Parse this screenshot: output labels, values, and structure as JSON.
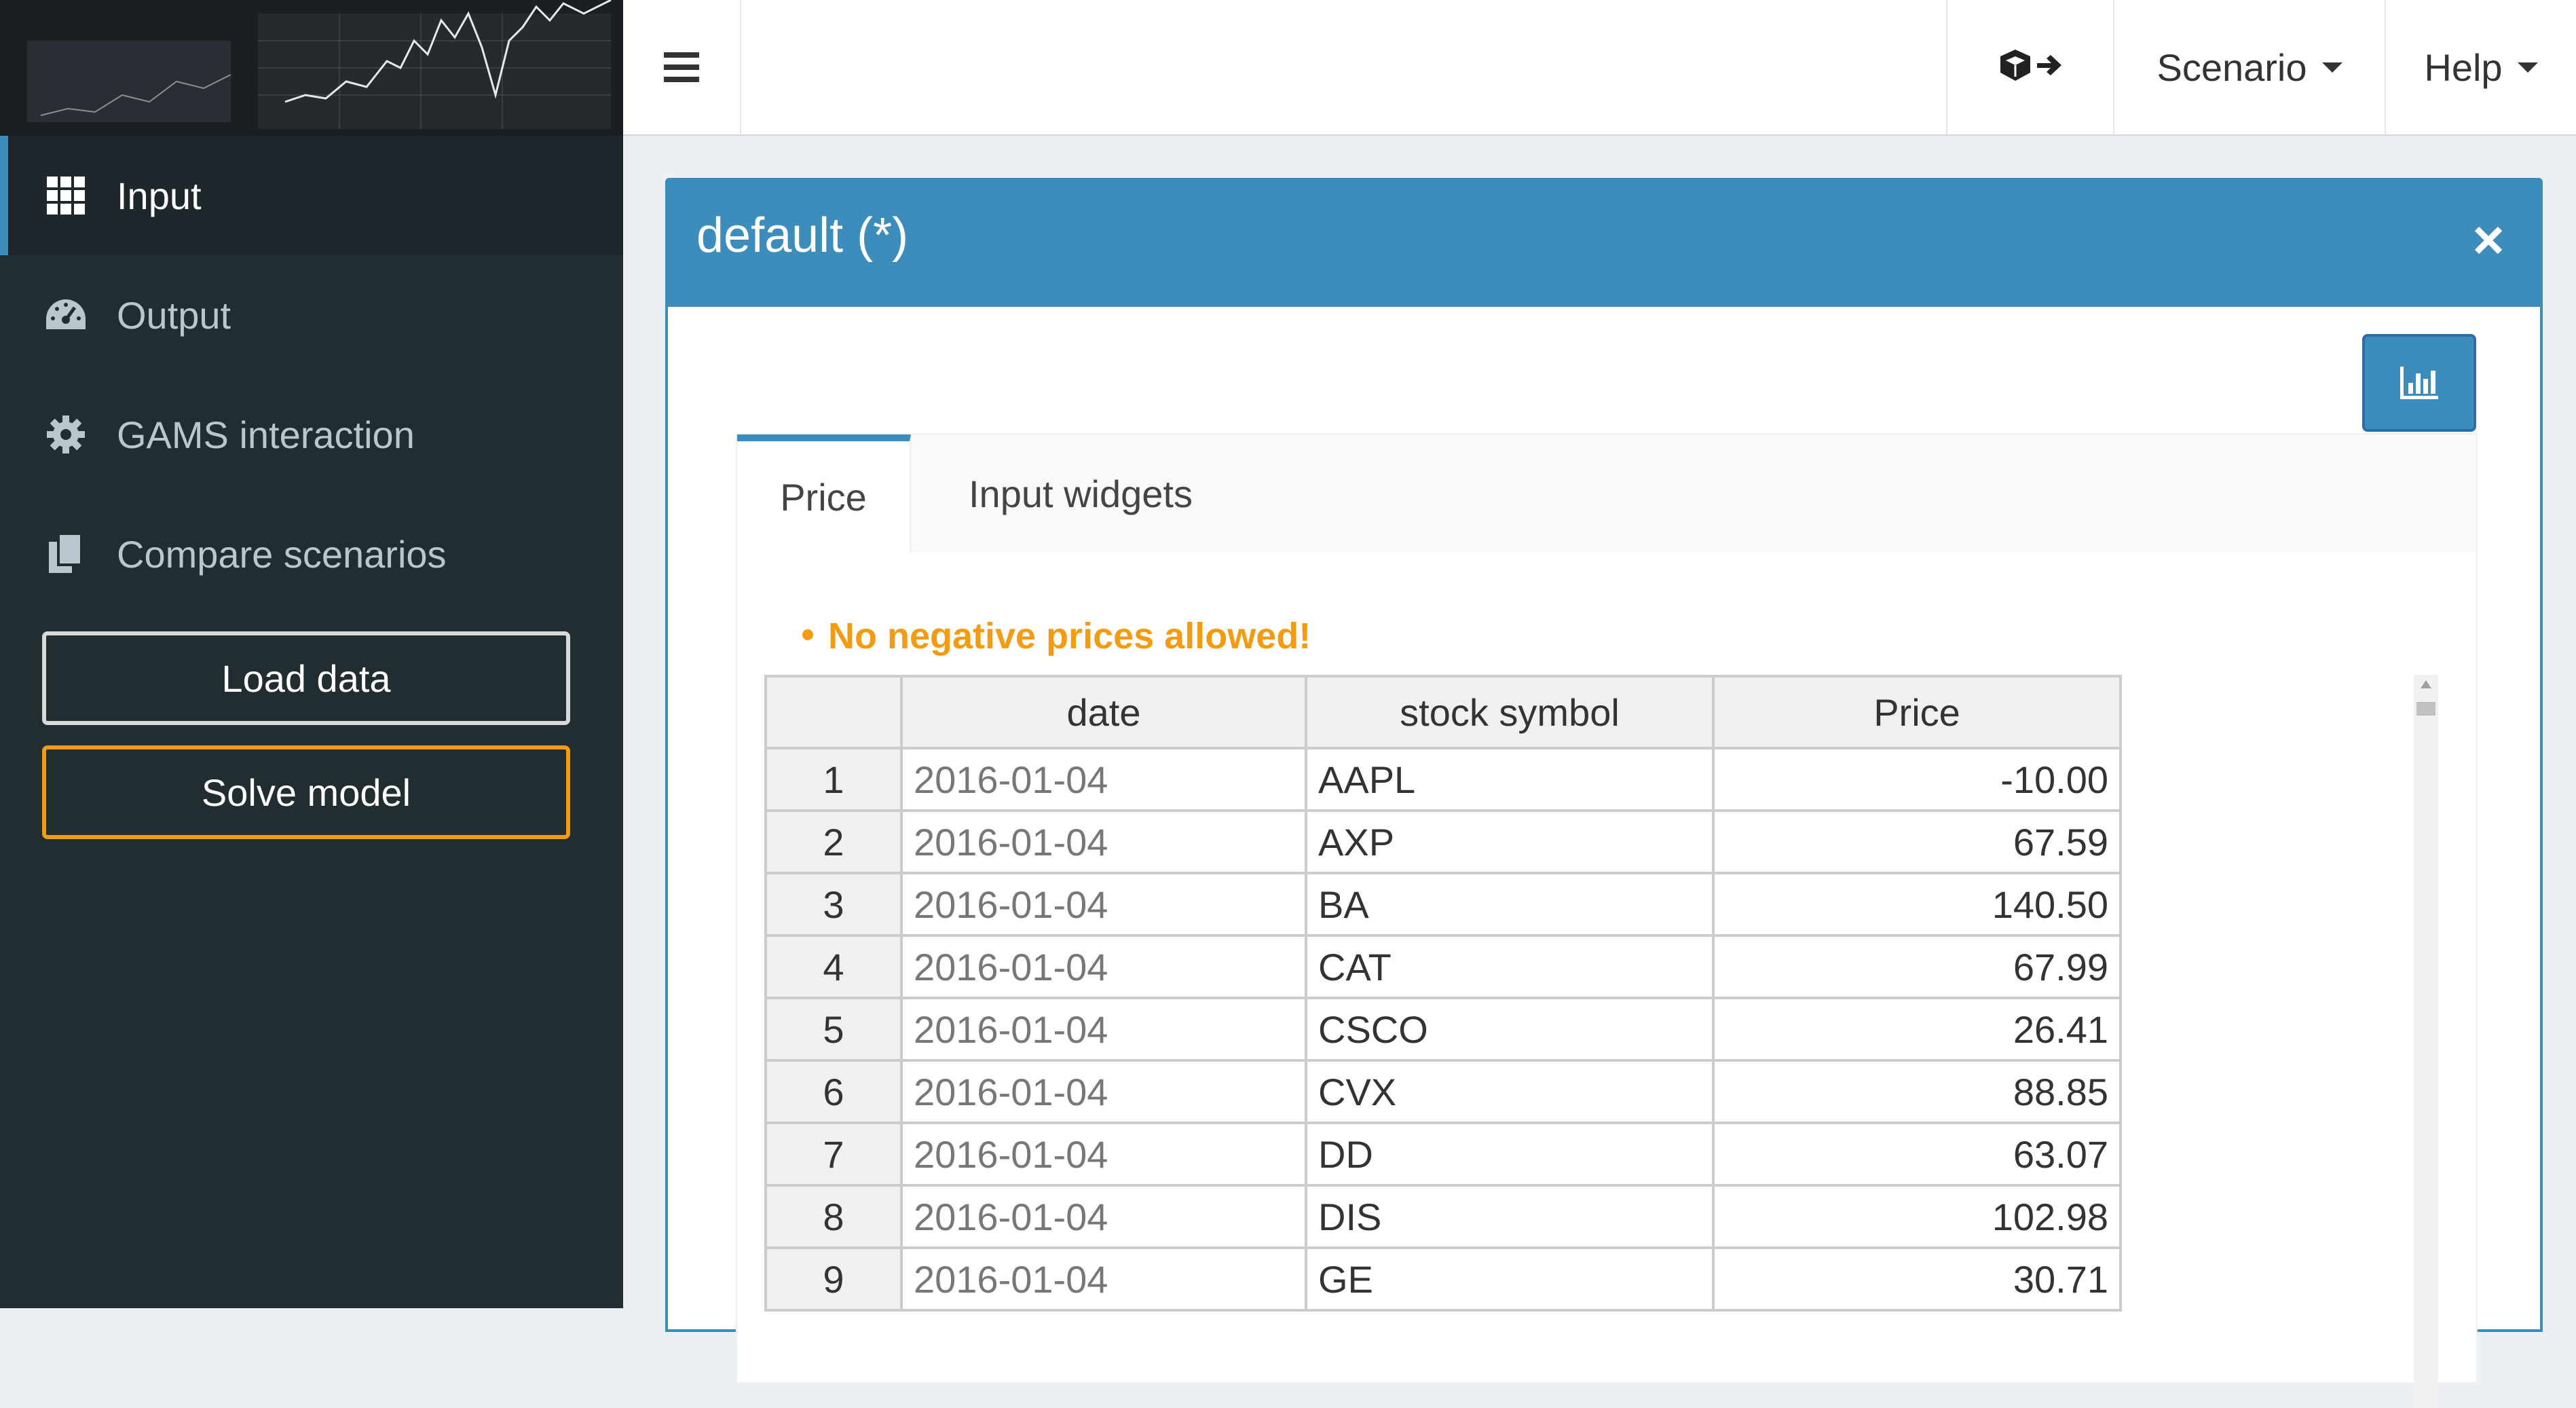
{
  "header": {
    "nav": {
      "export_label": "",
      "scenario_label": "Scenario",
      "help_label": "Help"
    }
  },
  "sidebar": {
    "items": [
      {
        "label": "Input",
        "icon": "grid-icon",
        "active": true
      },
      {
        "label": "Output",
        "icon": "dashboard-icon",
        "active": false
      },
      {
        "label": "GAMS interaction",
        "icon": "gear-icon",
        "active": false
      },
      {
        "label": "Compare scenarios",
        "icon": "copy-files-icon",
        "active": false
      }
    ],
    "load_button": "Load data",
    "solve_button": "Solve model"
  },
  "box": {
    "title": "default (*)",
    "tabs": [
      "Price",
      "Input widgets"
    ],
    "warning": "No negative prices allowed!"
  },
  "table": {
    "columns": [
      "",
      "date",
      "stock symbol",
      "Price"
    ],
    "rows": [
      [
        "1",
        "2016-01-04",
        "AAPL",
        "-10.00"
      ],
      [
        "2",
        "2016-01-04",
        "AXP",
        "67.59"
      ],
      [
        "3",
        "2016-01-04",
        "BA",
        "140.50"
      ],
      [
        "4",
        "2016-01-04",
        "CAT",
        "67.99"
      ],
      [
        "5",
        "2016-01-04",
        "CSCO",
        "26.41"
      ],
      [
        "6",
        "2016-01-04",
        "CVX",
        "88.85"
      ],
      [
        "7",
        "2016-01-04",
        "DD",
        "63.07"
      ],
      [
        "8",
        "2016-01-04",
        "DIS",
        "102.98"
      ],
      [
        "9",
        "2016-01-04",
        "GE",
        "30.71"
      ]
    ]
  },
  "colors": {
    "sidebar_bg": "#222d32",
    "accent": "#3c8dbc",
    "warning": "#f39c12"
  }
}
